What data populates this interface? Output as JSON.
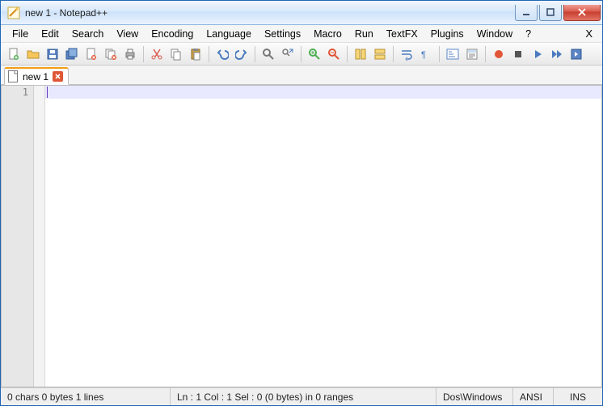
{
  "window": {
    "title": "new  1 - Notepad++"
  },
  "menu": {
    "items": [
      "File",
      "Edit",
      "Search",
      "View",
      "Encoding",
      "Language",
      "Settings",
      "Macro",
      "Run",
      "TextFX",
      "Plugins",
      "Window",
      "?"
    ],
    "xlabel": "X"
  },
  "toolbar": {
    "icons": [
      "new-file-icon",
      "open-file-icon",
      "save-icon",
      "save-all-icon",
      "close-icon",
      "close-all-icon",
      "print-icon",
      "cut-icon",
      "copy-icon",
      "paste-icon",
      "undo-icon",
      "redo-icon",
      "find-icon",
      "replace-icon",
      "zoom-in-icon",
      "zoom-out-icon",
      "sync-v-icon",
      "sync-h-icon",
      "wrap-icon",
      "show-all-icon",
      "indent-guide-icon",
      "doc-map-icon",
      "record-macro-icon",
      "stop-macro-icon",
      "play-macro-icon",
      "fast-forward-icon",
      "save-macro-icon"
    ],
    "groups": [
      7,
      3,
      2,
      2,
      2,
      2,
      2,
      2,
      5
    ]
  },
  "tabs": {
    "active": {
      "label": "new  1"
    }
  },
  "editor": {
    "line_numbers": [
      "1"
    ]
  },
  "status": {
    "counts": "0 chars   0 bytes   1 lines",
    "pos": "Ln : 1    Col : 1    Sel : 0 (0 bytes) in 0 ranges",
    "eol": "Dos\\Windows",
    "encoding": "ANSI",
    "mode": "INS"
  },
  "colors": {
    "accent": "#f39c12",
    "close": "#d9594b"
  }
}
